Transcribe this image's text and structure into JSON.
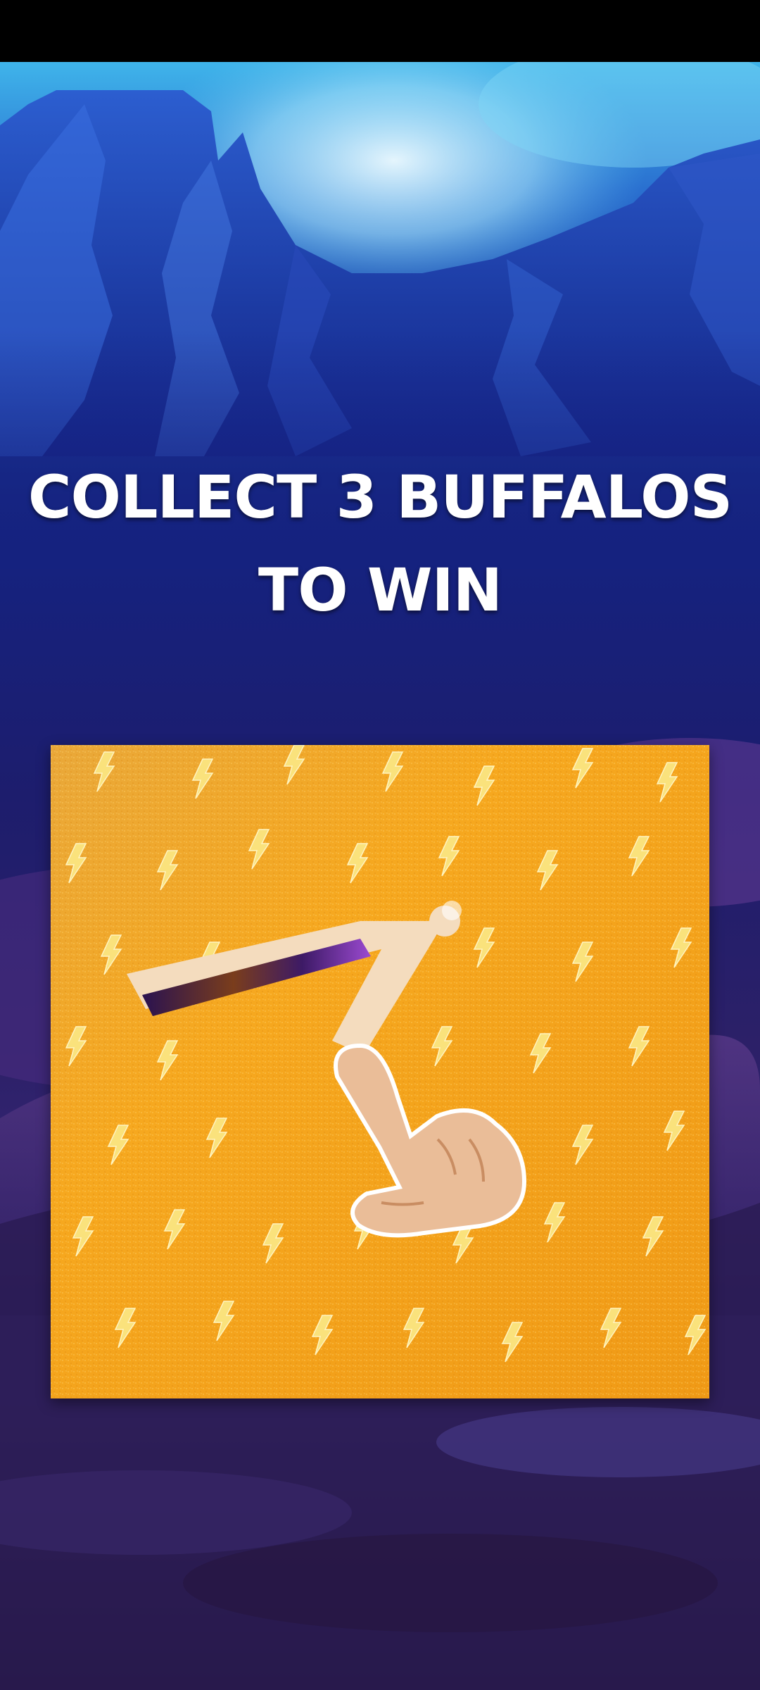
{
  "game": {
    "title_line1": "COLLECT 3 BUFFALOS",
    "title_line2": "TO WIN"
  },
  "scratch_card": {
    "surface_color": "#f2a621",
    "bolt_color": "#f9e17a",
    "revealed_color": "#f4dcbe",
    "hint_icon": "hand-pointer-icon"
  },
  "colors": {
    "sky": "#3fb4ea",
    "mountain": "#1f3fa5",
    "night": "#1d1d6d",
    "ground": "#2f1f52"
  }
}
